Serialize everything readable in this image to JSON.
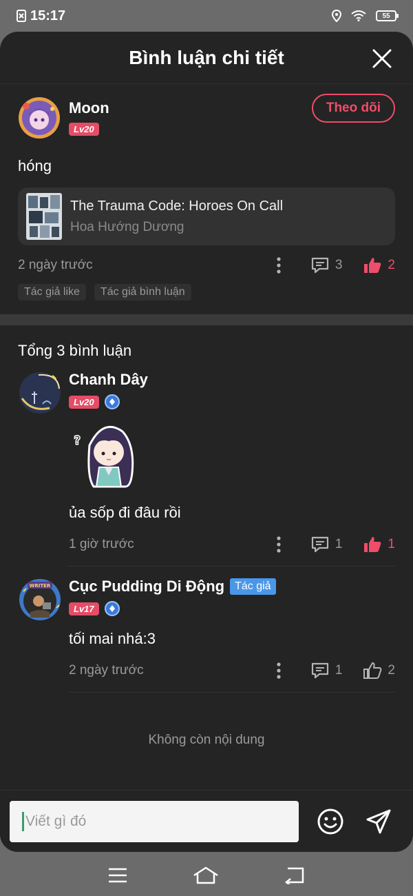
{
  "status_bar": {
    "time": "15:17",
    "battery": "55"
  },
  "header": {
    "title": "Bình luận chi tiết"
  },
  "post": {
    "author": "Moon",
    "level": "Lv20",
    "follow_label": "Theo dõi",
    "text": "hóng",
    "book": {
      "title": "The Trauma Code: Horoes On Call",
      "author": "Hoa Hướng Dương"
    },
    "time": "2 ngày trước",
    "comment_count": "3",
    "like_count": "2",
    "tags": [
      "Tác giả like",
      "Tác giả bình luận"
    ]
  },
  "comments_section": {
    "total_label": "Tổng 3 bình luận",
    "comments": [
      {
        "name": "Chanh Dây",
        "level": "Lv20",
        "text": "ủa sốp đi đâu rồi",
        "time": "1 giờ trước",
        "reply_count": "1",
        "like_count": "1",
        "liked": true
      },
      {
        "name": "Cục Pudding Di Động",
        "author_tag": "Tác giả",
        "level": "Lv17",
        "text": "tối mai nhá:3",
        "time": "2 ngày trước",
        "reply_count": "1",
        "like_count": "2",
        "liked": false
      }
    ],
    "end_label": "Không còn nội dung"
  },
  "composer": {
    "placeholder": "Viết gì đó"
  },
  "colors": {
    "accent": "#ef4d6a",
    "author_tag": "#4a97e8",
    "background": "#242424"
  },
  "icons": [
    "close-icon",
    "more-icon",
    "comment-icon",
    "like-icon",
    "emoji-icon",
    "send-icon",
    "menu-icon",
    "home-icon",
    "back-icon"
  ]
}
